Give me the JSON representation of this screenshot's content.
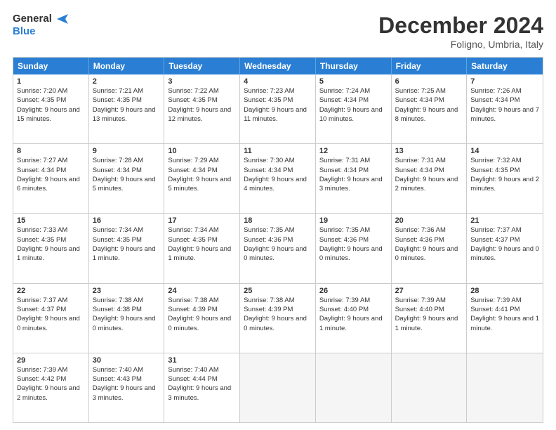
{
  "logo": {
    "line1": "General",
    "line2": "Blue"
  },
  "title": "December 2024",
  "subtitle": "Foligno, Umbria, Italy",
  "header_days": [
    "Sunday",
    "Monday",
    "Tuesday",
    "Wednesday",
    "Thursday",
    "Friday",
    "Saturday"
  ],
  "rows": [
    [
      {
        "day": "1",
        "sunrise": "Sunrise: 7:20 AM",
        "sunset": "Sunset: 4:35 PM",
        "daylight": "Daylight: 9 hours and 15 minutes."
      },
      {
        "day": "2",
        "sunrise": "Sunrise: 7:21 AM",
        "sunset": "Sunset: 4:35 PM",
        "daylight": "Daylight: 9 hours and 13 minutes."
      },
      {
        "day": "3",
        "sunrise": "Sunrise: 7:22 AM",
        "sunset": "Sunset: 4:35 PM",
        "daylight": "Daylight: 9 hours and 12 minutes."
      },
      {
        "day": "4",
        "sunrise": "Sunrise: 7:23 AM",
        "sunset": "Sunset: 4:35 PM",
        "daylight": "Daylight: 9 hours and 11 minutes."
      },
      {
        "day": "5",
        "sunrise": "Sunrise: 7:24 AM",
        "sunset": "Sunset: 4:34 PM",
        "daylight": "Daylight: 9 hours and 10 minutes."
      },
      {
        "day": "6",
        "sunrise": "Sunrise: 7:25 AM",
        "sunset": "Sunset: 4:34 PM",
        "daylight": "Daylight: 9 hours and 8 minutes."
      },
      {
        "day": "7",
        "sunrise": "Sunrise: 7:26 AM",
        "sunset": "Sunset: 4:34 PM",
        "daylight": "Daylight: 9 hours and 7 minutes."
      }
    ],
    [
      {
        "day": "8",
        "sunrise": "Sunrise: 7:27 AM",
        "sunset": "Sunset: 4:34 PM",
        "daylight": "Daylight: 9 hours and 6 minutes."
      },
      {
        "day": "9",
        "sunrise": "Sunrise: 7:28 AM",
        "sunset": "Sunset: 4:34 PM",
        "daylight": "Daylight: 9 hours and 5 minutes."
      },
      {
        "day": "10",
        "sunrise": "Sunrise: 7:29 AM",
        "sunset": "Sunset: 4:34 PM",
        "daylight": "Daylight: 9 hours and 5 minutes."
      },
      {
        "day": "11",
        "sunrise": "Sunrise: 7:30 AM",
        "sunset": "Sunset: 4:34 PM",
        "daylight": "Daylight: 9 hours and 4 minutes."
      },
      {
        "day": "12",
        "sunrise": "Sunrise: 7:31 AM",
        "sunset": "Sunset: 4:34 PM",
        "daylight": "Daylight: 9 hours and 3 minutes."
      },
      {
        "day": "13",
        "sunrise": "Sunrise: 7:31 AM",
        "sunset": "Sunset: 4:34 PM",
        "daylight": "Daylight: 9 hours and 2 minutes."
      },
      {
        "day": "14",
        "sunrise": "Sunrise: 7:32 AM",
        "sunset": "Sunset: 4:35 PM",
        "daylight": "Daylight: 9 hours and 2 minutes."
      }
    ],
    [
      {
        "day": "15",
        "sunrise": "Sunrise: 7:33 AM",
        "sunset": "Sunset: 4:35 PM",
        "daylight": "Daylight: 9 hours and 1 minute."
      },
      {
        "day": "16",
        "sunrise": "Sunrise: 7:34 AM",
        "sunset": "Sunset: 4:35 PM",
        "daylight": "Daylight: 9 hours and 1 minute."
      },
      {
        "day": "17",
        "sunrise": "Sunrise: 7:34 AM",
        "sunset": "Sunset: 4:35 PM",
        "daylight": "Daylight: 9 hours and 1 minute."
      },
      {
        "day": "18",
        "sunrise": "Sunrise: 7:35 AM",
        "sunset": "Sunset: 4:36 PM",
        "daylight": "Daylight: 9 hours and 0 minutes."
      },
      {
        "day": "19",
        "sunrise": "Sunrise: 7:35 AM",
        "sunset": "Sunset: 4:36 PM",
        "daylight": "Daylight: 9 hours and 0 minutes."
      },
      {
        "day": "20",
        "sunrise": "Sunrise: 7:36 AM",
        "sunset": "Sunset: 4:36 PM",
        "daylight": "Daylight: 9 hours and 0 minutes."
      },
      {
        "day": "21",
        "sunrise": "Sunrise: 7:37 AM",
        "sunset": "Sunset: 4:37 PM",
        "daylight": "Daylight: 9 hours and 0 minutes."
      }
    ],
    [
      {
        "day": "22",
        "sunrise": "Sunrise: 7:37 AM",
        "sunset": "Sunset: 4:37 PM",
        "daylight": "Daylight: 9 hours and 0 minutes."
      },
      {
        "day": "23",
        "sunrise": "Sunrise: 7:38 AM",
        "sunset": "Sunset: 4:38 PM",
        "daylight": "Daylight: 9 hours and 0 minutes."
      },
      {
        "day": "24",
        "sunrise": "Sunrise: 7:38 AM",
        "sunset": "Sunset: 4:39 PM",
        "daylight": "Daylight: 9 hours and 0 minutes."
      },
      {
        "day": "25",
        "sunrise": "Sunrise: 7:38 AM",
        "sunset": "Sunset: 4:39 PM",
        "daylight": "Daylight: 9 hours and 0 minutes."
      },
      {
        "day": "26",
        "sunrise": "Sunrise: 7:39 AM",
        "sunset": "Sunset: 4:40 PM",
        "daylight": "Daylight: 9 hours and 1 minute."
      },
      {
        "day": "27",
        "sunrise": "Sunrise: 7:39 AM",
        "sunset": "Sunset: 4:40 PM",
        "daylight": "Daylight: 9 hours and 1 minute."
      },
      {
        "day": "28",
        "sunrise": "Sunrise: 7:39 AM",
        "sunset": "Sunset: 4:41 PM",
        "daylight": "Daylight: 9 hours and 1 minute."
      }
    ],
    [
      {
        "day": "29",
        "sunrise": "Sunrise: 7:39 AM",
        "sunset": "Sunset: 4:42 PM",
        "daylight": "Daylight: 9 hours and 2 minutes."
      },
      {
        "day": "30",
        "sunrise": "Sunrise: 7:40 AM",
        "sunset": "Sunset: 4:43 PM",
        "daylight": "Daylight: 9 hours and 3 minutes."
      },
      {
        "day": "31",
        "sunrise": "Sunrise: 7:40 AM",
        "sunset": "Sunset: 4:44 PM",
        "daylight": "Daylight: 9 hours and 3 minutes."
      },
      null,
      null,
      null,
      null
    ]
  ]
}
